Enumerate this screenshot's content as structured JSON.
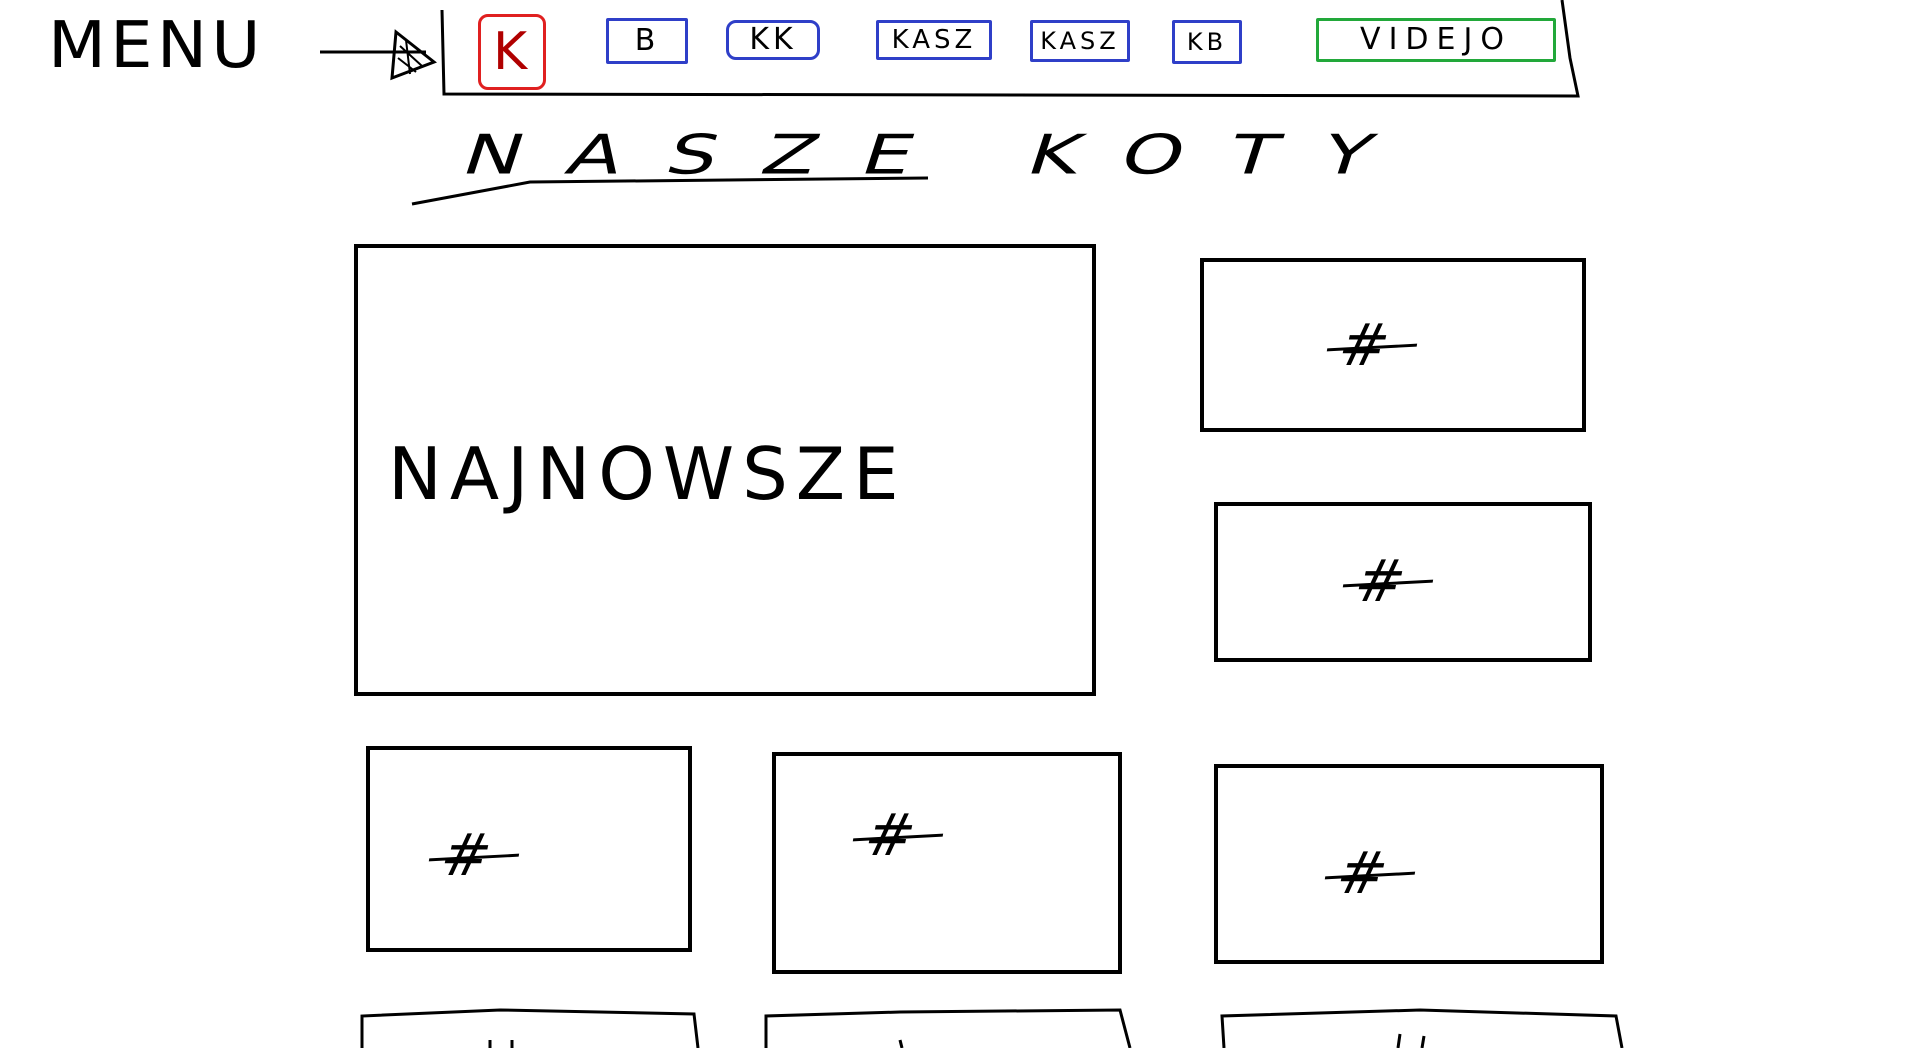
{
  "menu": {
    "label": "MENU",
    "colors": {
      "active_outline": "#e02020",
      "item_outline": "#2f3fc8",
      "video_outline": "#22a83a"
    },
    "items": [
      {
        "label": "K",
        "state": "active"
      },
      {
        "label": "B",
        "state": "default"
      },
      {
        "label": "KK",
        "state": "default"
      },
      {
        "label": "KASZ",
        "state": "default"
      },
      {
        "label": "KASZ",
        "state": "default"
      },
      {
        "label": "KB",
        "state": "default"
      },
      {
        "label": "VIDEJO",
        "state": "video"
      }
    ]
  },
  "page": {
    "title": "NASZE KOTY"
  },
  "grid": {
    "featured_label": "NAJNOWSZE",
    "placeholder_symbol": "#"
  }
}
